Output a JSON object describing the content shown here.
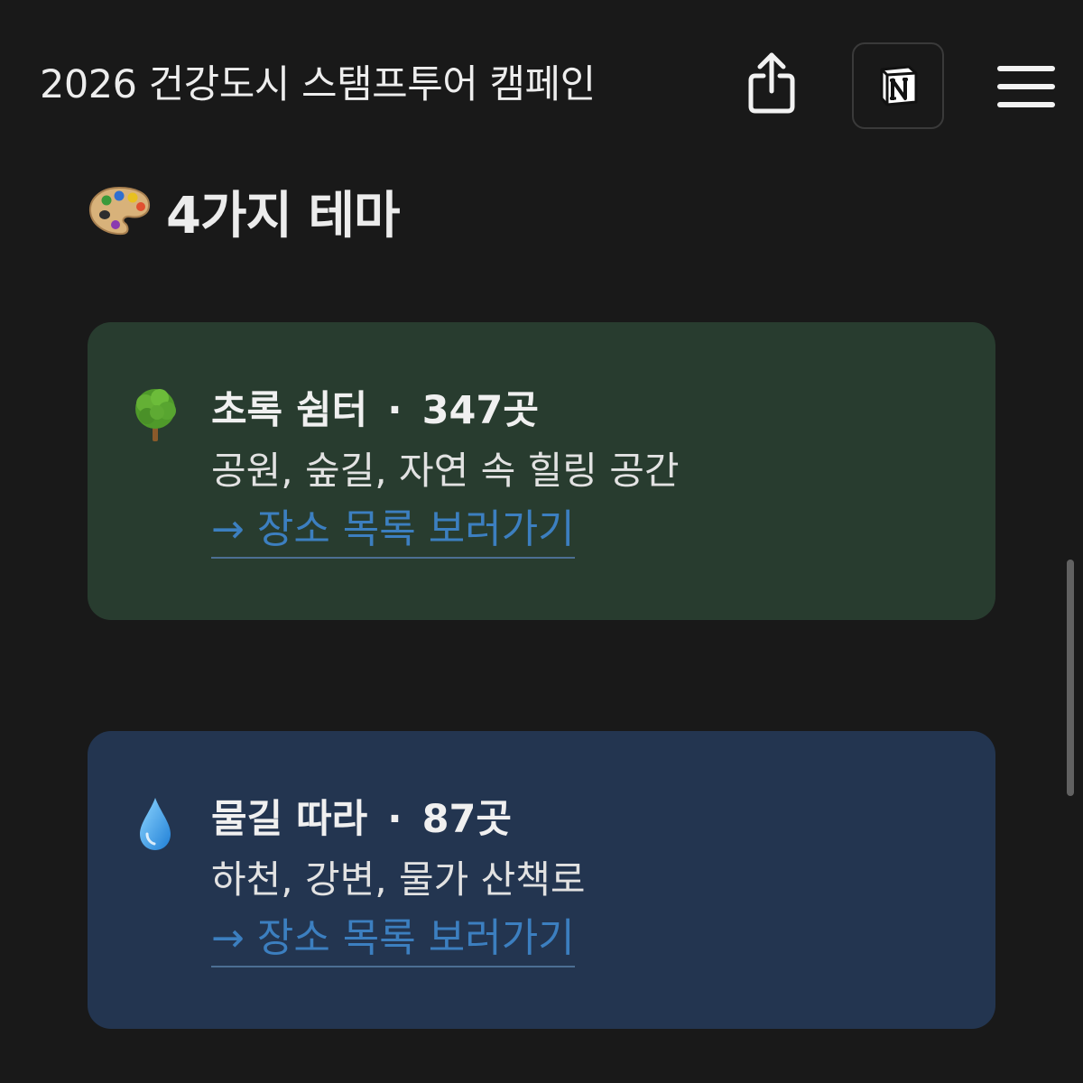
{
  "header": {
    "title": "2026 건강도시 스탬프투어 캠페인",
    "share_icon": "share-icon",
    "notion_icon": "notion-logo-icon",
    "menu_icon": "hamburger-menu-icon"
  },
  "section": {
    "icon": "palette-icon",
    "heading": "4가지 테마"
  },
  "themes": [
    {
      "icon": "tree-icon",
      "name": "초록 쉼터",
      "separator": "·",
      "count": "347곳",
      "description": "공원, 숲길, 자연 속 힐링 공간",
      "link_label": "→ 장소 목록 보러가기",
      "color": "#283c2f"
    },
    {
      "icon": "droplet-icon",
      "name": "물길 따라",
      "separator": "·",
      "count": "87곳",
      "description": "하천, 강변, 물가 산책로",
      "link_label": "→ 장소 목록 보러가기",
      "color": "#233550"
    }
  ],
  "colors": {
    "background": "#191919",
    "link": "#3c7fc0"
  }
}
